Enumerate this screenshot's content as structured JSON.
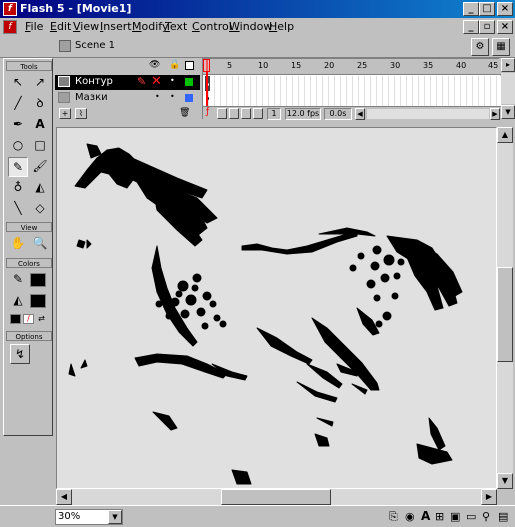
{
  "window": {
    "title": "Flash 5 - [Movie1]"
  },
  "menu": [
    {
      "label": "File",
      "u": "F",
      "rest": "ile"
    },
    {
      "label": "Edit",
      "u": "E",
      "rest": "dit"
    },
    {
      "label": "View",
      "u": "V",
      "rest": "iew"
    },
    {
      "label": "Insert",
      "u": "I",
      "rest": "nsert"
    },
    {
      "label": "Modify",
      "u": "M",
      "rest": "odify"
    },
    {
      "label": "Text",
      "u": "T",
      "rest": "ext"
    },
    {
      "label": "Control",
      "u": "C",
      "rest": "ontrol"
    },
    {
      "label": "Window",
      "u": "W",
      "rest": "indow"
    },
    {
      "label": "Help",
      "u": "H",
      "rest": "elp"
    }
  ],
  "scene": {
    "label": "Scene 1"
  },
  "toolbox": {
    "tools_label": "Tools",
    "view_label": "View",
    "colors_label": "Colors",
    "options_label": "Options"
  },
  "timeline": {
    "layers": [
      {
        "name": "Контур",
        "selected": true
      },
      {
        "name": "Мазки",
        "selected": false
      }
    ],
    "frame_numbers": [
      "5",
      "10",
      "15",
      "20",
      "25",
      "30",
      "35",
      "40",
      "45"
    ],
    "current_frame": "1",
    "fps": "12.0 fps",
    "elapsed": "0.0s"
  },
  "status": {
    "zoom": "30%"
  },
  "colors": {
    "titlebar_start": "#000080",
    "titlebar_end": "#1084d0",
    "stage": "#e0e0e0",
    "playhead": "#ff0000",
    "layer_color_1": "#00c000",
    "layer_color_2": "#3366ff"
  }
}
